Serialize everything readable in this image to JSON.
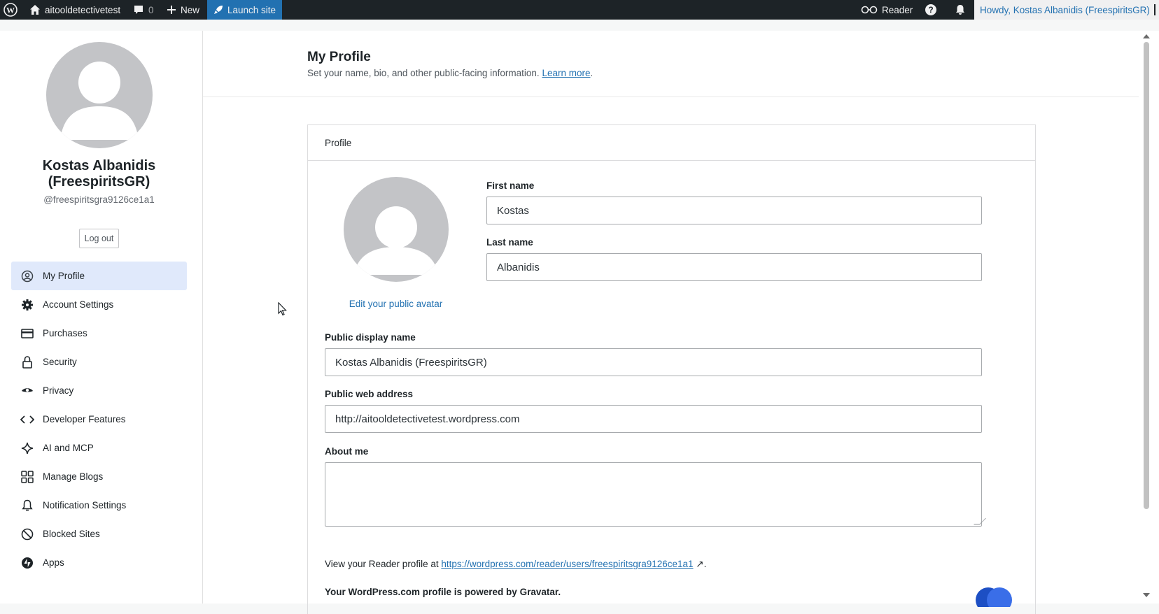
{
  "adminbar": {
    "site_name": "aitooldetectivetest",
    "comments_count": "0",
    "new_label": "New",
    "launch_label": "Launch site",
    "reader_label": "Reader",
    "howdy_label": "Howdy, Kostas Albanidis (FreespiritsGR)"
  },
  "sidebar": {
    "display_name": "Kostas Albanidis (FreespiritsGR)",
    "handle": "@freespiritsgra9126ce1a1",
    "logout_label": "Log out",
    "items": [
      {
        "label": "My Profile",
        "icon": "user-circle-icon",
        "active": true
      },
      {
        "label": "Account Settings",
        "icon": "gear-icon"
      },
      {
        "label": "Purchases",
        "icon": "credit-card-icon"
      },
      {
        "label": "Security",
        "icon": "lock-icon"
      },
      {
        "label": "Privacy",
        "icon": "eye-icon"
      },
      {
        "label": "Developer Features",
        "icon": "code-icon"
      },
      {
        "label": "AI and MCP",
        "icon": "sparkle-icon"
      },
      {
        "label": "Manage Blogs",
        "icon": "grid-icon"
      },
      {
        "label": "Notification Settings",
        "icon": "bell-icon"
      },
      {
        "label": "Blocked Sites",
        "icon": "block-icon"
      },
      {
        "label": "Apps",
        "icon": "jetpack-icon"
      }
    ]
  },
  "header": {
    "title": "My Profile",
    "subtitle": "Set your name, bio, and other public-facing information.",
    "learn_more": "Learn more",
    "period": "."
  },
  "profile": {
    "card_title": "Profile",
    "edit_avatar": "Edit your public avatar",
    "first_name_label": "First name",
    "first_name_value": "Kostas",
    "last_name_label": "Last name",
    "last_name_value": "Albanidis",
    "display_name_label": "Public display name",
    "display_name_value": "Kostas Albanidis (FreespiritsGR)",
    "web_address_label": "Public web address",
    "web_address_value": "http://aitooldetectivetest.wordpress.com",
    "about_label": "About me",
    "about_value": "",
    "reader_prefix": "View your Reader profile at ",
    "reader_link": "https://wordpress.com/reader/users/freespiritsgra9126ce1a1",
    "reader_suffix": " ↗.",
    "powered_by": "Your WordPress.com profile is powered by Gravatar."
  }
}
